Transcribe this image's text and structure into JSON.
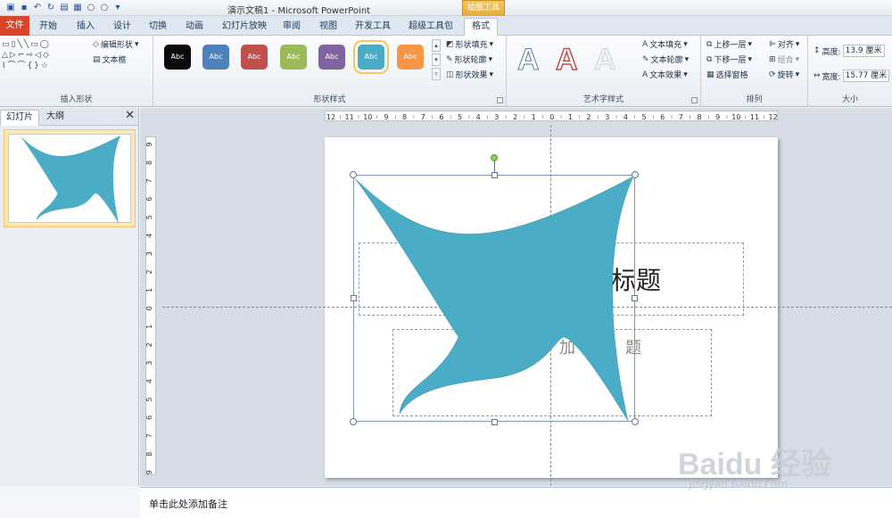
{
  "window": {
    "title": "演示文稿1 - Microsoft PowerPoint",
    "context_tab": "绘图工具"
  },
  "ribbon_tabs": [
    {
      "label": "文件"
    },
    {
      "label": "开始"
    },
    {
      "label": "插入"
    },
    {
      "label": "设计"
    },
    {
      "label": "切换"
    },
    {
      "label": "动画"
    },
    {
      "label": "幻灯片放映"
    },
    {
      "label": "审阅"
    },
    {
      "label": "视图"
    },
    {
      "label": "开发工具"
    },
    {
      "label": "超级工具包"
    },
    {
      "label": "格式"
    }
  ],
  "insert_shapes": {
    "edit_shape": "编辑形状",
    "text_box": "文本框",
    "group_label": "插入形状"
  },
  "shape_styles": {
    "swatch_label": "Abc",
    "swatches": [
      {
        "color": "#0a0a0a"
      },
      {
        "color": "#4f81bd"
      },
      {
        "color": "#c0504d"
      },
      {
        "color": "#9bbb59"
      },
      {
        "color": "#8064a2"
      },
      {
        "color": "#4bacc6",
        "selected": true
      },
      {
        "color": "#f79646"
      }
    ],
    "fill": "形状填充",
    "outline": "形状轮廓",
    "effects": "形状效果",
    "group_label": "形状样式"
  },
  "wordart": {
    "letter": "A",
    "text_fill": "文本填充",
    "text_outline": "文本轮廓",
    "text_effects": "文本效果",
    "group_label": "艺术字样式"
  },
  "arrange": {
    "bring_forward": "上移一层",
    "send_backward": "下移一层",
    "selection_pane": "选择窗格",
    "align": "对齐",
    "group": "组合",
    "rotate": "旋转",
    "group_label": "排列"
  },
  "size": {
    "height_label": "高度:",
    "height_value": "13.9 厘米",
    "width_label": "宽度:",
    "width_value": "15.77 厘米",
    "group_label": "大小"
  },
  "left_pane": {
    "tab_slides": "幻灯片",
    "tab_outline": "大纲",
    "close": "✕",
    "slide_number": "1"
  },
  "ruler": {
    "h_labels": [
      "12",
      "11",
      "10",
      "9",
      "8",
      "7",
      "6",
      "5",
      "4",
      "3",
      "2",
      "1",
      "0",
      "1",
      "2",
      "3",
      "4",
      "5",
      "6",
      "7",
      "8",
      "9",
      "10",
      "11",
      "12"
    ],
    "v_labels": [
      "9",
      "8",
      "7",
      "6",
      "5",
      "4",
      "3",
      "2",
      "1",
      "0",
      "1",
      "2",
      "3",
      "4",
      "5",
      "6",
      "7",
      "8",
      "9"
    ]
  },
  "slide": {
    "title_visible": "标题",
    "subtitle_visible_left": "加",
    "subtitle_visible_right": "题",
    "shape_color": "#4bacc6"
  },
  "notes": {
    "placeholder": "单击此处添加备注"
  },
  "watermark": {
    "text": "Baidu 经验",
    "url": "jingyan.baidu.com"
  }
}
